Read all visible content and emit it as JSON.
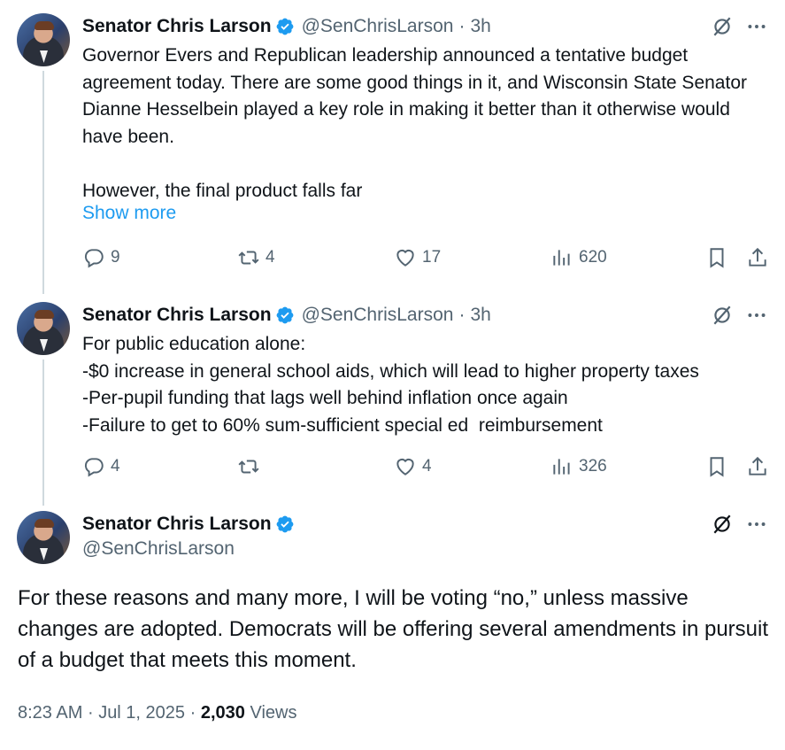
{
  "tweets": [
    {
      "name": "Senator Chris Larson",
      "handle": "@SenChrisLarson",
      "time": "3h",
      "text": "Governor Evers and Republican leadership announced a tentative budget agreement today. There are some good things in it, and Wisconsin State Senator Dianne Hesselbein played a key role in making it better than it otherwise would have been.\n\nHowever, the final product falls far",
      "show_more": "Show more",
      "replies": "9",
      "reposts": "4",
      "likes": "17",
      "views": "620"
    },
    {
      "name": "Senator Chris Larson",
      "handle": "@SenChrisLarson",
      "time": "3h",
      "text": "For public education alone:\n-$0 increase in general school aids, which will lead to higher property taxes\n-Per-pupil funding that lags well behind inflation once again\n-Failure to get to 60% sum-sufficient special ed  reimbursement",
      "replies": "4",
      "reposts": "",
      "likes": "4",
      "views": "326"
    }
  ],
  "main": {
    "name": "Senator Chris Larson",
    "handle": "@SenChrisLarson",
    "text": "For these reasons and many more, I will be voting “no,” unless massive changes are adopted. Democrats will be offering several amendments in pursuit of a budget that meets this moment.",
    "time": "8:23 AM",
    "date": "Jul 1, 2025",
    "views_count": "2,030",
    "views_label": "Views"
  },
  "separator": "·",
  "icons": {
    "verified": "verified-badge-icon",
    "grok": "grok-slash-icon",
    "more": "more-dots-icon",
    "reply": "reply-icon",
    "repost": "repost-icon",
    "like": "heart-icon",
    "views": "views-bar-icon",
    "bookmark": "bookmark-icon",
    "share": "share-icon"
  },
  "colors": {
    "accent": "#1d9bf0",
    "muted": "#536471",
    "text": "#0f1419",
    "thread": "#cfd9de"
  }
}
